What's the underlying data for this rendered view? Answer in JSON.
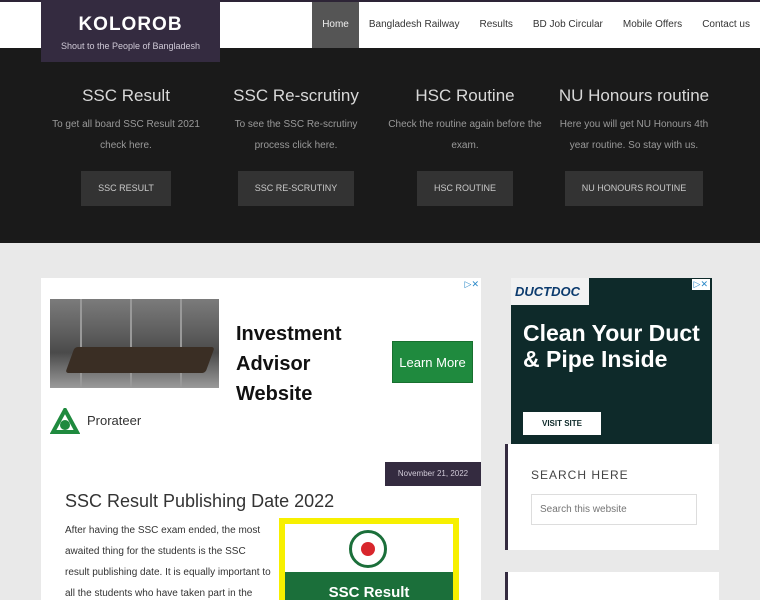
{
  "site": {
    "title": "KOLOROB",
    "tagline": "Shout to the People of Bangladesh"
  },
  "nav": [
    {
      "label": "Home",
      "active": true
    },
    {
      "label": "Bangladesh Railway"
    },
    {
      "label": "Results"
    },
    {
      "label": "BD Job Circular"
    },
    {
      "label": "Mobile Offers"
    },
    {
      "label": "Contact us"
    }
  ],
  "hero": [
    {
      "heading": "SSC Result",
      "text": "To get all board SSC Result 2021 check here.",
      "button": "SSC RESULT"
    },
    {
      "heading": "SSC Re-scrutiny",
      "text": "To see the SSC Re-scrutiny process click here.",
      "button": "SSC RE-SCRUTINY"
    },
    {
      "heading": "HSC Routine",
      "text": "Check the routine again before the exam.",
      "button": "HSC ROUTINE"
    },
    {
      "heading": "NU Honours routine",
      "text": "Here you will get NU Honours 4th year routine. So stay with us.",
      "button": "NU HONOURS ROUTINE"
    }
  ],
  "ad_left": {
    "headline": "Investment Advisor Website",
    "cta": "Learn More",
    "advertiser": "Prorateer",
    "adchoice": "▷✕"
  },
  "ad_right": {
    "brand": "DUCTDOC",
    "headline": "Clean Your Duct & Pipe Inside",
    "cta": "VISIT SITE",
    "adchoice": "▷✕"
  },
  "post": {
    "date": "November 21, 2022",
    "title": "SSC Result Publishing Date 2022",
    "excerpt": "After having the SSC exam ended, the most awaited thing for the students is the SSC result publishing date. It is equally important to all the students who have taken part in the SSC, Dakhil,",
    "thumb_text": "SSC Result"
  },
  "sidebar": {
    "search_title": "SEARCH HERE",
    "search_placeholder": "Search this website"
  },
  "colors": {
    "brand_bg": "#342b40",
    "hero_bg": "#1a1a1a",
    "page_bg": "#e9e9e9",
    "cta_green": "#1f8a3e"
  }
}
